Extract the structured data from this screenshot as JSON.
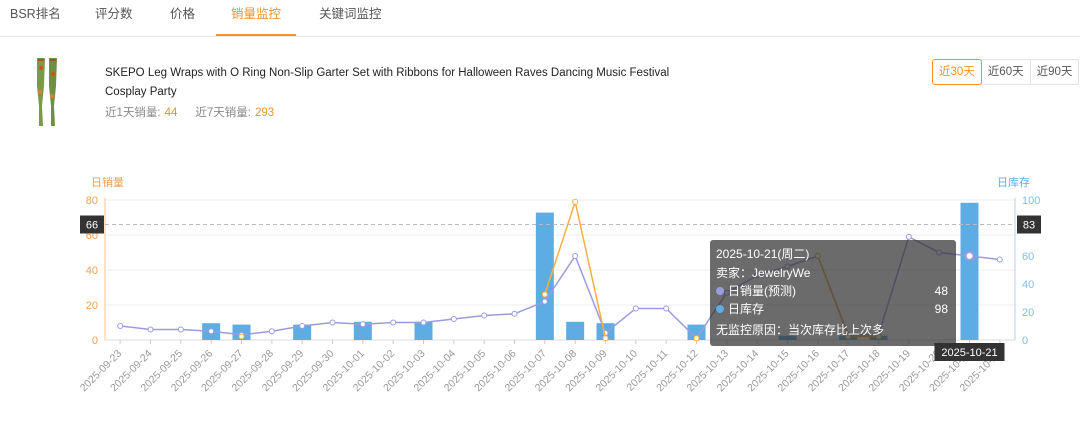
{
  "tabs": [
    "BSR排名",
    "评分数",
    "价格",
    "销量监控",
    "关键词监控"
  ],
  "active_tab": "销量监控",
  "product": {
    "title": "SKEPO Leg Wraps with O Ring Non-Slip Garter Set with Ribbons for Halloween Raves Dancing Music Festival Cosplay Party",
    "sales_1d_label": "近1天销量:",
    "sales_1d": "44",
    "sales_7d_label": "近7天销量:",
    "sales_7d": "293"
  },
  "ranges": [
    "近30天",
    "近60天",
    "近90天"
  ],
  "active_range": "近30天",
  "colors": {
    "sales": "#f5b041",
    "inventory": "#5dade2",
    "trend": "#9b9be0",
    "accent": "#f0932b"
  },
  "chart_data": {
    "type": "bar",
    "left_axis_label": "日销量",
    "right_axis_label": "日库存",
    "left_ylim": [
      0,
      80
    ],
    "right_ylim": [
      0,
      100
    ],
    "left_ticks": [
      0,
      20,
      40,
      60,
      80
    ],
    "right_ticks": [
      0,
      20,
      40,
      60,
      80,
      100
    ],
    "categories": [
      "2025-09-23",
      "2025-09-24",
      "2025-09-25",
      "2025-09-26",
      "2025-09-27",
      "2025-09-28",
      "2025-09-29",
      "2025-09-30",
      "2025-10-01",
      "2025-10-02",
      "2025-10-03",
      "2025-10-04",
      "2025-10-05",
      "2025-10-06",
      "2025-10-07",
      "2025-10-08",
      "2025-10-09",
      "2025-10-10",
      "2025-10-11",
      "2025-10-12",
      "2025-10-13",
      "2025-10-14",
      "2025-10-15",
      "2025-10-16",
      "2025-10-17",
      "2025-10-18",
      "2025-10-19",
      "2025-10-20",
      "2025-10-21",
      "2025-10-22"
    ],
    "series": [
      {
        "name": "日库存",
        "kind": "bar",
        "axis": "right",
        "values": [
          null,
          null,
          null,
          12,
          11,
          null,
          11,
          null,
          13,
          null,
          13,
          null,
          null,
          null,
          91,
          13,
          12,
          null,
          null,
          11,
          null,
          null,
          3,
          null,
          3,
          3,
          null,
          null,
          98,
          null
        ]
      },
      {
        "name": "日销量",
        "kind": "line",
        "axis": "left",
        "values": [
          null,
          null,
          null,
          null,
          2,
          null,
          null,
          null,
          null,
          null,
          null,
          null,
          null,
          null,
          26,
          79,
          1,
          null,
          null,
          1,
          null,
          null,
          null,
          48,
          2,
          2,
          null,
          null,
          null,
          null
        ]
      },
      {
        "name": "日销量(预测)",
        "kind": "line",
        "axis": "left",
        "values": [
          8,
          6,
          6,
          5,
          3,
          5,
          8,
          10,
          9,
          10,
          10,
          12,
          14,
          15,
          22,
          48,
          4,
          18,
          18,
          1,
          27,
          37,
          42,
          48,
          3,
          3,
          59,
          50,
          48,
          46
        ]
      }
    ],
    "crosshair": {
      "left_value": "66",
      "right_value": "83",
      "x_label": "2025-10-21"
    },
    "tooltip": {
      "date": "2025-10-21(周二)",
      "seller": "卖家：JewelryWe",
      "rows": [
        {
          "label": "日销量(预测)",
          "value": "48"
        },
        {
          "label": "日库存",
          "value": "98"
        }
      ],
      "note": "无监控原因：当次库存比上次多"
    }
  }
}
